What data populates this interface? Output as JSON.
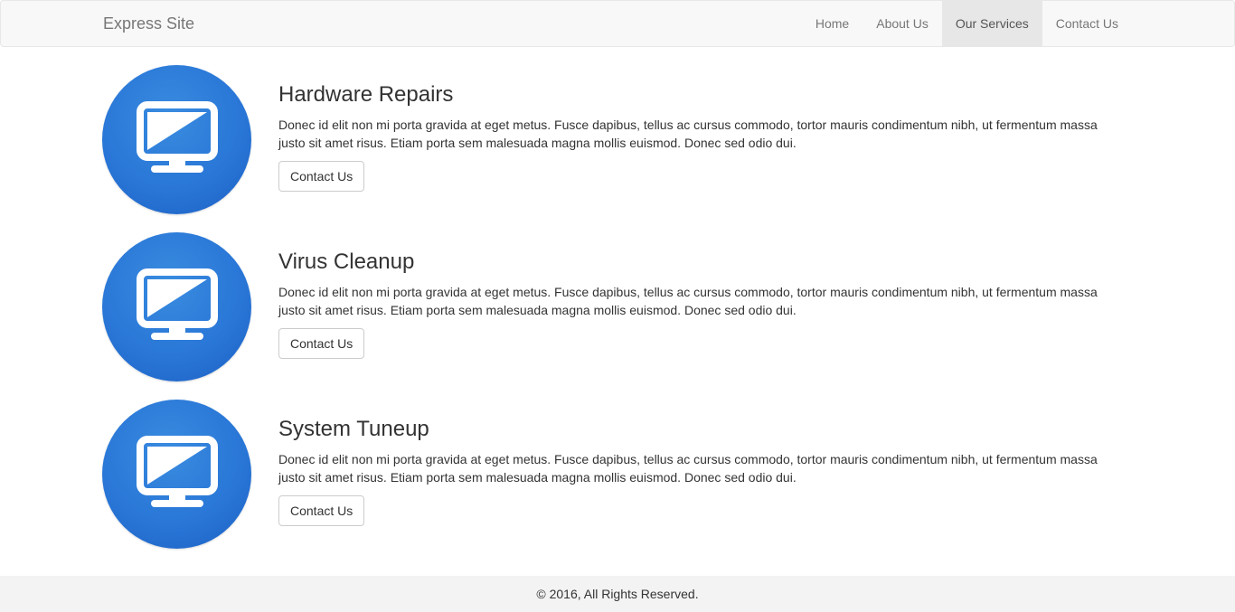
{
  "navbar": {
    "brand": "Express Site",
    "items": [
      {
        "label": "Home",
        "active": false
      },
      {
        "label": "About Us",
        "active": false
      },
      {
        "label": "Our Services",
        "active": true
      },
      {
        "label": "Contact Us",
        "active": false
      }
    ]
  },
  "services": [
    {
      "title": "Hardware Repairs",
      "description": "Donec id elit non mi porta gravida at eget metus. Fusce dapibus, tellus ac cursus commodo, tortor mauris condimentum nibh, ut fermentum massa justo sit amet risus. Etiam porta sem malesuada magna mollis euismod. Donec sed odio dui.",
      "button_label": "Contact Us",
      "icon": "monitor-icon"
    },
    {
      "title": "Virus Cleanup",
      "description": "Donec id elit non mi porta gravida at eget metus. Fusce dapibus, tellus ac cursus commodo, tortor mauris condimentum nibh, ut fermentum massa justo sit amet risus. Etiam porta sem malesuada magna mollis euismod. Donec sed odio dui.",
      "button_label": "Contact Us",
      "icon": "monitor-icon"
    },
    {
      "title": "System Tuneup",
      "description": "Donec id elit non mi porta gravida at eget metus. Fusce dapibus, tellus ac cursus commodo, tortor mauris condimentum nibh, ut fermentum massa justo sit amet risus. Etiam porta sem malesuada magna mollis euismod. Donec sed odio dui.",
      "button_label": "Contact Us",
      "icon": "monitor-icon"
    }
  ],
  "footer": {
    "text": "© 2016, All Rights Reserved."
  },
  "colors": {
    "accent": "#2875d6",
    "navbar_bg": "#f8f8f8",
    "active_nav_bg": "#e7e7e7",
    "footer_bg": "#f3f3f3"
  }
}
